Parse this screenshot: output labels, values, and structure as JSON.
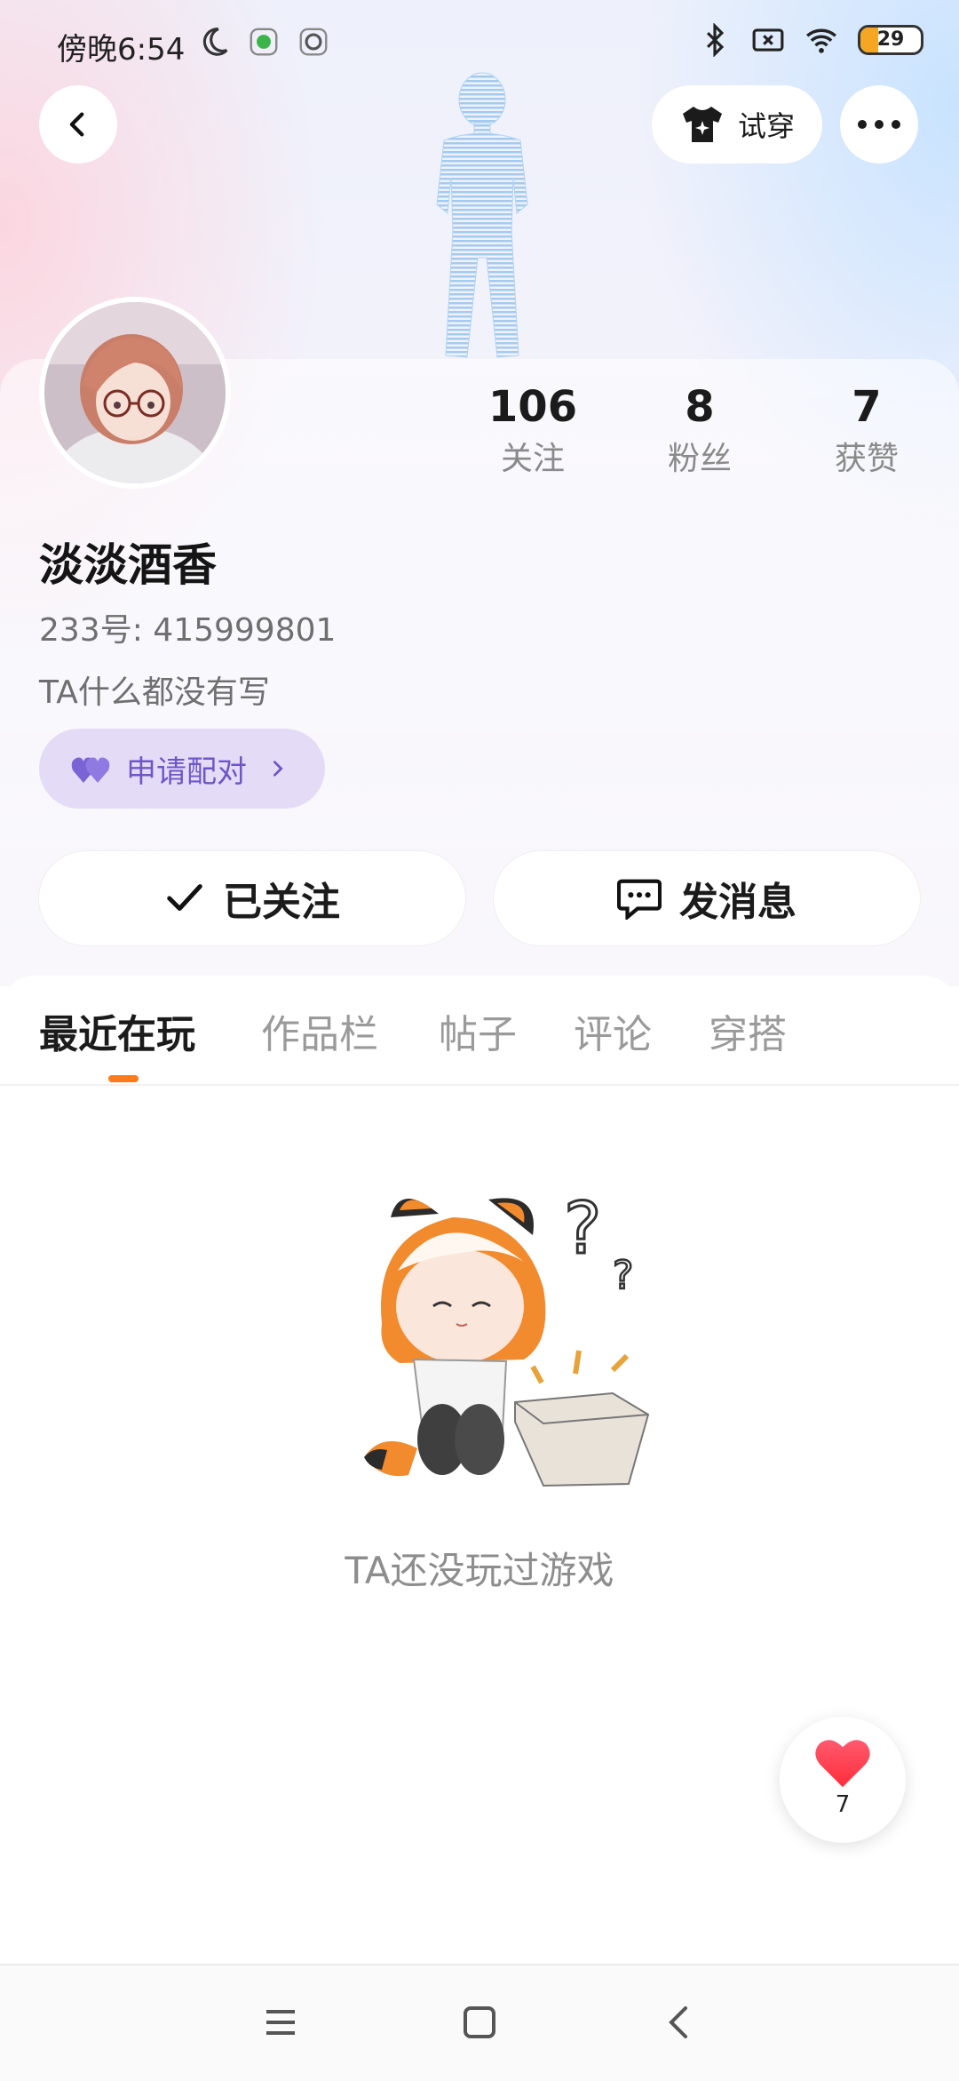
{
  "status_bar": {
    "time": "傍晚6:54",
    "battery": "29",
    "icons": [
      "moon-icon",
      "app-notification-icon",
      "app-notification-icon",
      "bluetooth-icon",
      "sim-off-icon",
      "wifi-icon",
      "battery-icon"
    ]
  },
  "header": {
    "back_icon": "chevron-left-icon",
    "try_on_label": "试穿",
    "more_icon": "more-dots-icon"
  },
  "profile": {
    "nickname": "淡淡酒香",
    "uid": "233号: 415999801",
    "bio": "TA什么都没有写",
    "pair_button_label": "申请配对",
    "stats": [
      {
        "value": "106",
        "label": "关注"
      },
      {
        "value": "8",
        "label": "粉丝"
      },
      {
        "value": "7",
        "label": "获赞"
      }
    ]
  },
  "actions": {
    "follow_label": "已关注",
    "message_label": "发消息"
  },
  "tabs": [
    {
      "label": "最近在玩",
      "active": true
    },
    {
      "label": "作品栏",
      "active": false
    },
    {
      "label": "帖子",
      "active": false
    },
    {
      "label": "评论",
      "active": false
    },
    {
      "label": "穿搭",
      "active": false
    }
  ],
  "empty_state": {
    "message": "TA还没玩过游戏"
  },
  "like_fab": {
    "count": "7"
  },
  "colors": {
    "accent_orange": "#ff7a1a",
    "pair_purple": "#6e56c9",
    "pair_bg": "#e4dcf6"
  }
}
